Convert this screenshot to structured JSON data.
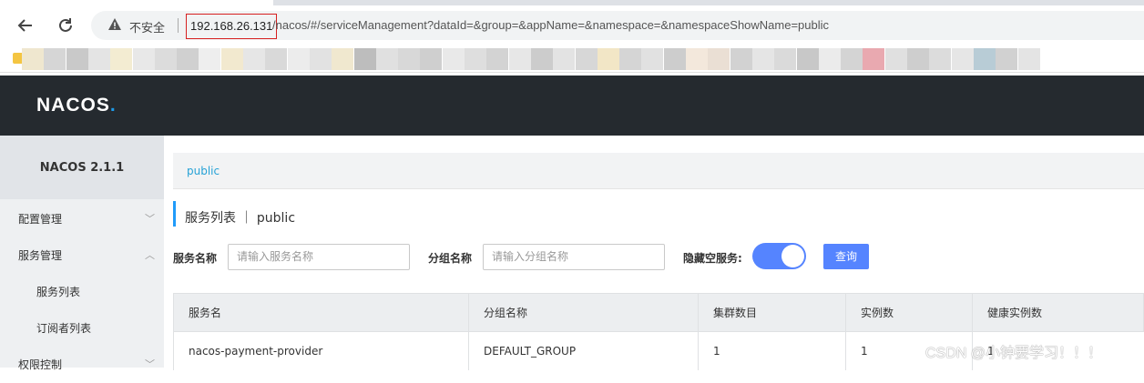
{
  "browser": {
    "insecure_label": "不安全",
    "url_host": "192.168.26.131",
    "url_path": "/nacos/#/serviceManagement?dataId=&group=&appName=&namespace=&namespaceShowName=public",
    "bookmark_colors": [
      "#efe7cf",
      "#d6d6d6",
      "#c9c9c9",
      "#e4e4e4",
      "#f3ecd2",
      "#e8e8e8",
      "#dcdcdc",
      "#d0d0d0",
      "#eeeeee",
      "#f2e9cf",
      "#e6e6e6",
      "#d9d9d9",
      "#ececec",
      "#e2e2e2",
      "#f0e8cf",
      "#bdbdbd",
      "#e0e0e0",
      "#d8d8d8",
      "#cfcfcf",
      "#e9e9e9",
      "#dedede",
      "#d3d3d3",
      "#e7e7e7",
      "#cccccc",
      "#e3e3e3",
      "#d7d7d7",
      "#f2e6c6",
      "#d5d5d5",
      "#e1e1e1",
      "#cdcdcd",
      "#f3e8dc",
      "#eadfd4",
      "#d2d2d2",
      "#e5e5e5",
      "#dadada",
      "#c8c8c8",
      "#ebebeb",
      "#d4d4d4",
      "#e9a9b0",
      "#e0e0e0",
      "#cecece",
      "#dcdcdc",
      "#e6e6e6",
      "#b8ccd6",
      "#d1d1d1",
      "#e4e4e4"
    ]
  },
  "app": {
    "logo_text": "NACOS",
    "logo_dot": ".",
    "version": "NACOS 2.1.1"
  },
  "sidebar": {
    "items": [
      {
        "label": "配置管理",
        "chevron": "﹀"
      },
      {
        "label": "服务管理",
        "chevron": "︿"
      },
      {
        "label": "服务列表"
      },
      {
        "label": "订阅者列表"
      },
      {
        "label": "权限控制",
        "chevron": "﹀"
      }
    ]
  },
  "main": {
    "breadcrumb": "public",
    "title": "服务列表 ｜ public",
    "filters": {
      "service_name_label": "服务名称",
      "service_name_placeholder": "请输入服务名称",
      "group_name_label": "分组名称",
      "group_name_placeholder": "请输入分组名称",
      "hide_empty_label": "隐藏空服务:",
      "hide_empty_on": true,
      "query_button": "查询"
    },
    "table": {
      "headers": [
        "服务名",
        "分组名称",
        "集群数目",
        "实例数",
        "健康实例数"
      ],
      "rows": [
        [
          "nacos-payment-provider",
          "DEFAULT_GROUP",
          "1",
          "1",
          "1"
        ]
      ]
    }
  },
  "watermark": "CSDN @小钟要学习！！！"
}
